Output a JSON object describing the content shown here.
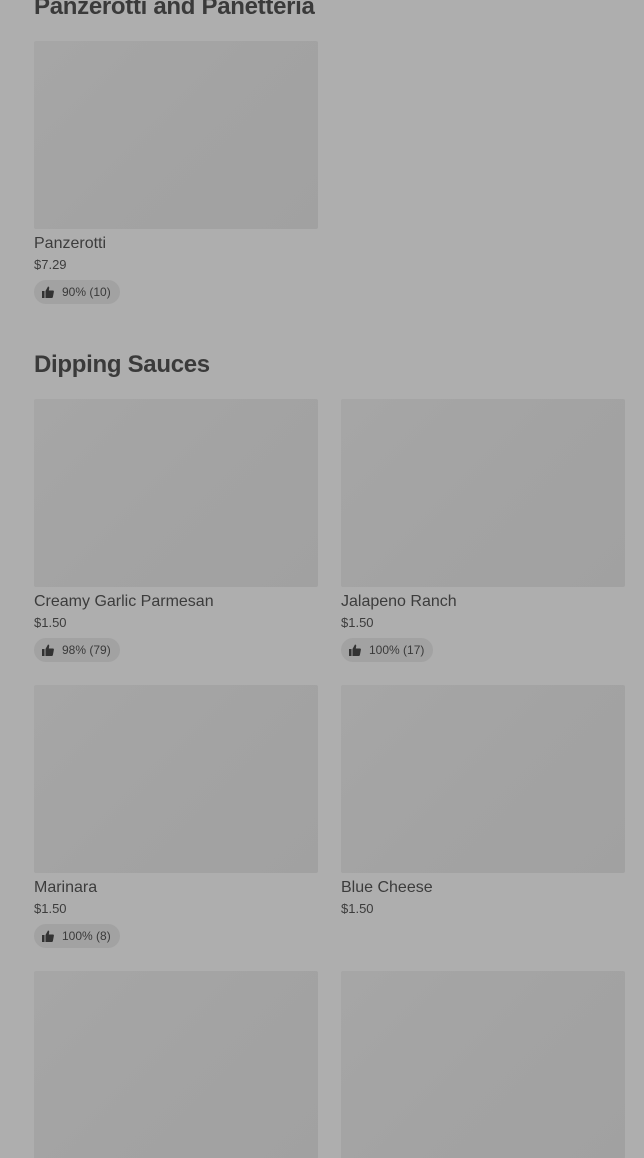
{
  "sections": [
    {
      "title": "Panzerotti and Panetteria",
      "items": [
        {
          "name": "Panzerotti",
          "price": "$7.29",
          "rating": "90% (10)"
        }
      ]
    },
    {
      "title": "Dipping Sauces",
      "items": [
        {
          "name": "Creamy Garlic Parmesan",
          "price": "$1.50",
          "rating": "98% (79)"
        },
        {
          "name": "Jalapeno Ranch",
          "price": "$1.50",
          "rating": "100% (17)"
        },
        {
          "name": "Marinara",
          "price": "$1.50",
          "rating": "100% (8)"
        },
        {
          "name": "Blue Cheese",
          "price": "$1.50",
          "rating": ""
        },
        {
          "name": "",
          "price": "",
          "rating": ""
        },
        {
          "name": "",
          "price": "",
          "rating": ""
        }
      ]
    }
  ],
  "icons": {
    "rating": "thumbs-up-icon"
  },
  "colors": {
    "overlay_background": "#aeaeae",
    "image_placeholder": "#a4a4a4",
    "rating_pill": "#a2a2a2",
    "text": "#3c3c3c"
  }
}
